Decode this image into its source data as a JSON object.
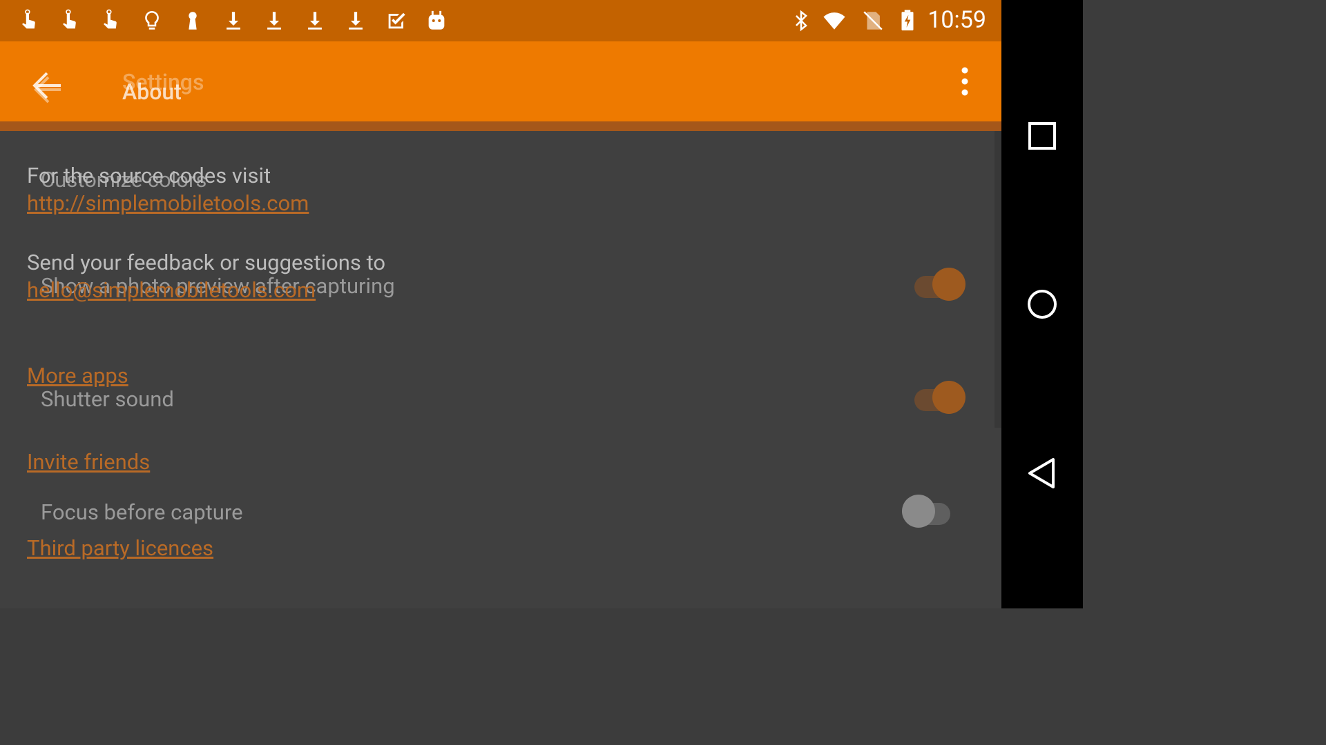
{
  "status_bar": {
    "time": "10:59",
    "left_icons": [
      "touch-icon",
      "touch-icon",
      "touch-icon",
      "lightbulb-icon",
      "keyhole-icon",
      "download-icon",
      "download-icon",
      "download-icon",
      "download-icon",
      "checkbox-icon",
      "android-icon"
    ],
    "right_icons": [
      "bluetooth-icon",
      "wifi-icon",
      "no-sim-icon",
      "battery-charging-icon"
    ]
  },
  "toolbar": {
    "title_back": "Settings",
    "title_front": "About",
    "back_icon": "arrow-back-icon",
    "menu_icon": "more-vert-icon",
    "color": "#ee7a00"
  },
  "about": {
    "source_text": "For the source codes visit",
    "source_link": "http://simplemobiletools.com",
    "feedback_text": "Send your feedback or suggestions to",
    "feedback_link": "hello@simplemobiletools.com",
    "more_apps": "More apps",
    "invite_friends": "Invite friends",
    "third_party": "Third party licences"
  },
  "settings": {
    "customize_colors": "Customize colors",
    "photo_preview": {
      "label": "Show a photo preview after capturing",
      "on": true
    },
    "shutter_sound": {
      "label": "Shutter sound",
      "on": true
    },
    "focus_before_capture": {
      "label": "Focus before capture",
      "on": false
    }
  },
  "nav_bar": {
    "recents_icon": "square-icon",
    "home_icon": "circle-icon",
    "back_icon": "triangle-back-icon"
  }
}
